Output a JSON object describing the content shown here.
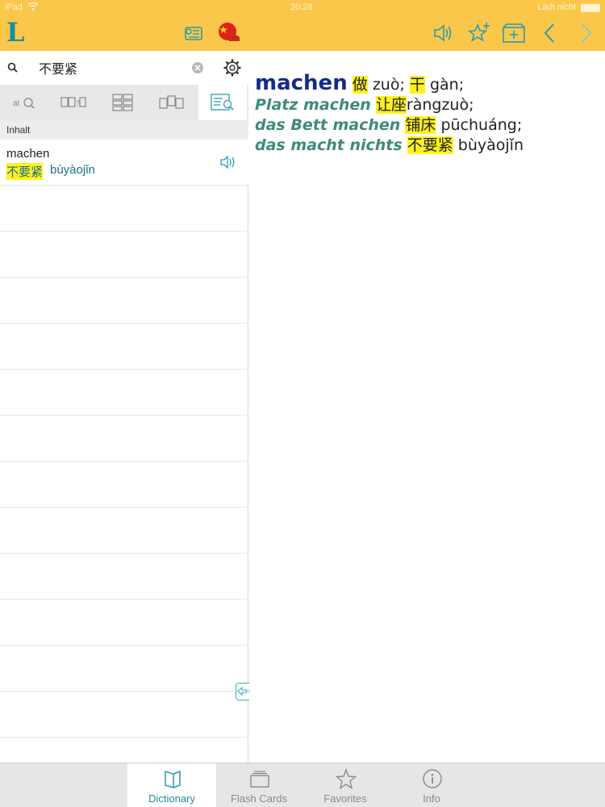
{
  "status_bar": {
    "carrier": "iPad",
    "time": "20:28",
    "battery_text": "Lädt nicht"
  },
  "toolbar": {
    "logo": "L",
    "icons": [
      "flashcard-add-icon",
      "china-flag-icon",
      "speaker-icon",
      "star-add-icon",
      "folder-add-icon",
      "back-arrow-icon",
      "forward-arrow-icon"
    ],
    "accent_color": "#fbc74a"
  },
  "search": {
    "value": "不要紧",
    "placeholder": ""
  },
  "modes": [
    "letter-search-icon",
    "wildcard-search-icon",
    "grid-search-icon",
    "compare-search-icon",
    "fulltext-search-icon"
  ],
  "section": {
    "label": "Inhalt"
  },
  "results": [
    {
      "word": "machen",
      "chinese": "不要紧",
      "pinyin": "bùyàojǐn"
    }
  ],
  "entry": {
    "headword": "machen",
    "translations": [
      {
        "zh": "做",
        "py": "zuò;"
      },
      {
        "zh": "干",
        "py": "gàn;"
      }
    ],
    "phrases": [
      {
        "de": "Platz machen",
        "zh": "让座",
        "py": "ràngzuò;"
      },
      {
        "de": "das Bett machen",
        "zh": "铺床",
        "py": "pūchuáng;"
      },
      {
        "de": "das macht nichts",
        "zh": "不要紧",
        "py": "bùyàojǐn"
      }
    ]
  },
  "tabs": [
    {
      "label": "Dictionary",
      "icon": "book-icon",
      "active": true
    },
    {
      "label": "Flash Cards",
      "icon": "cards-icon",
      "active": false
    },
    {
      "label": "Favorites",
      "icon": "star-icon",
      "active": false
    },
    {
      "label": "Info",
      "icon": "info-icon",
      "active": false
    }
  ]
}
